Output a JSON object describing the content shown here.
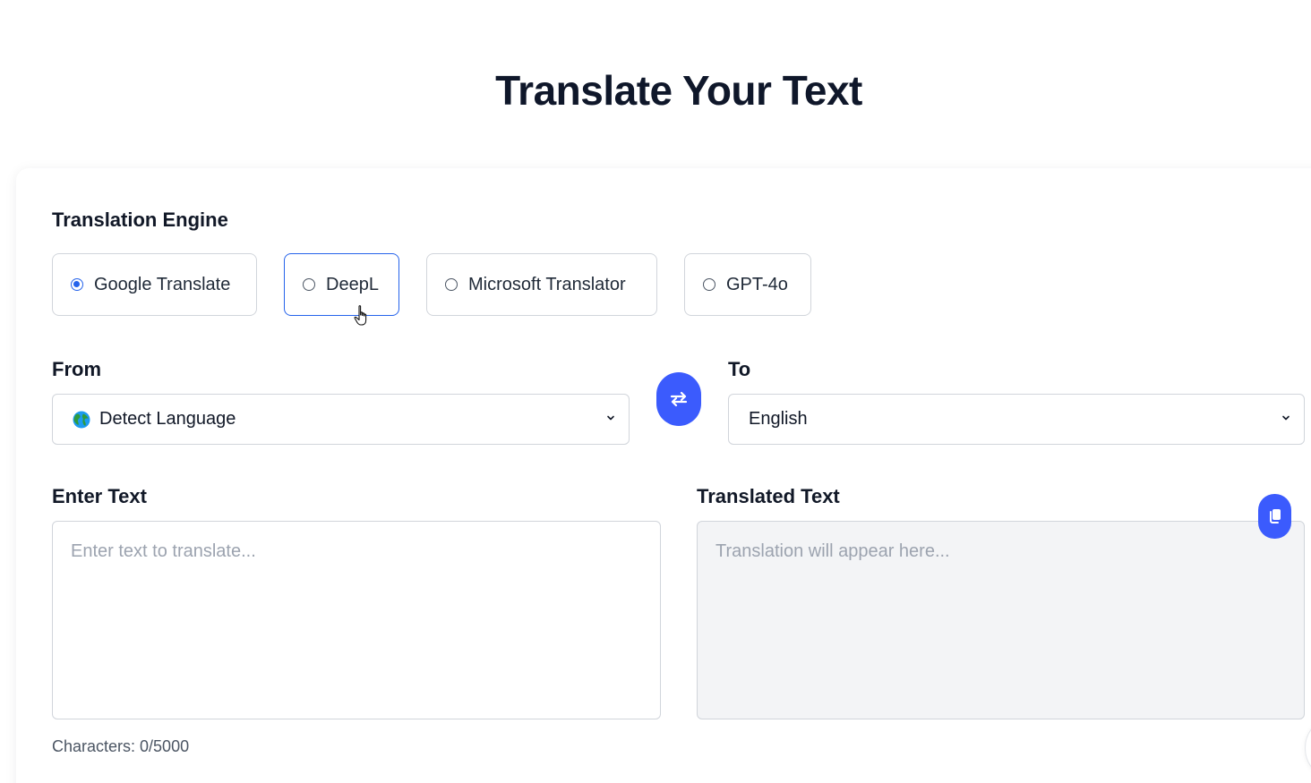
{
  "page": {
    "title": "Translate Your Text"
  },
  "engine": {
    "label": "Translation Engine",
    "options": [
      {
        "label": "Google Translate",
        "selected": true
      },
      {
        "label": "DeepL",
        "selected": false
      },
      {
        "label": "Microsoft Translator",
        "selected": false
      },
      {
        "label": "GPT-4o",
        "selected": false
      }
    ]
  },
  "languages": {
    "from_label": "From",
    "from_value": "Detect Language",
    "from_icon": "globe-icon",
    "to_label": "To",
    "to_value": "English",
    "swap_icon": "swap-arrows-icon"
  },
  "input": {
    "label": "Enter Text",
    "placeholder": "Enter text to translate...",
    "value": "",
    "char_count": "Characters: 0/5000"
  },
  "output": {
    "label": "Translated Text",
    "placeholder": "Translation will appear here...",
    "copy_icon": "copy-icon"
  },
  "colors": {
    "accent": "#3b5bfd",
    "radio_selected": "#2563eb",
    "output_bg": "#f3f4f6"
  }
}
